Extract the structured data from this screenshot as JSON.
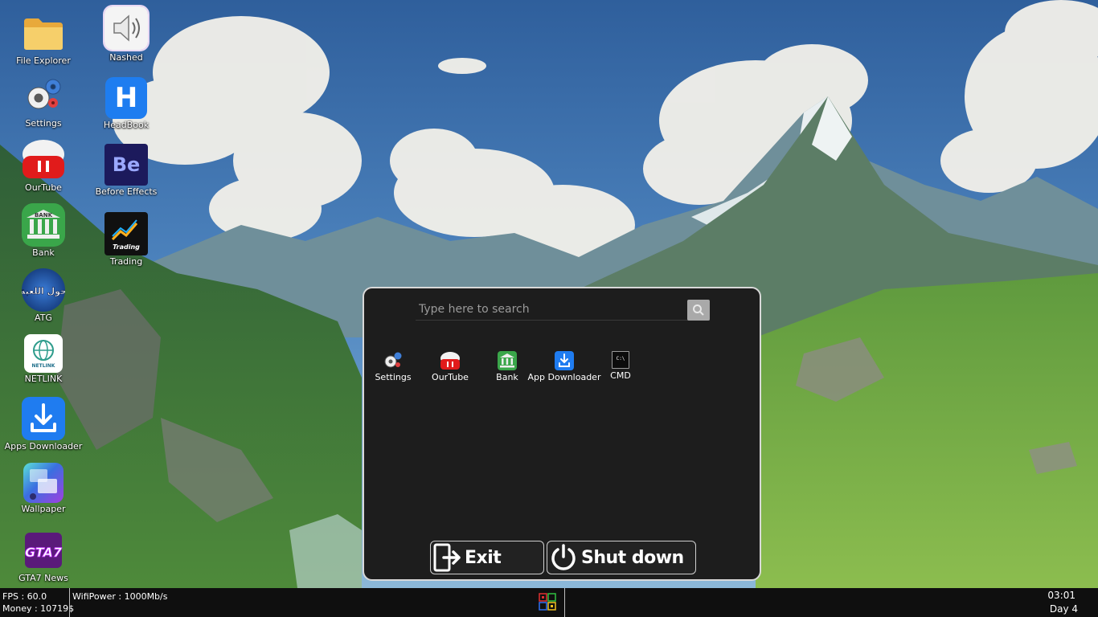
{
  "desktop": {
    "icons": [
      {
        "label": "File Explorer"
      },
      {
        "label": "Nashed"
      },
      {
        "label": "Settings"
      },
      {
        "label": "HeadBook"
      },
      {
        "label": "OurTube"
      },
      {
        "label": "Before Effects"
      },
      {
        "label": "Bank"
      },
      {
        "label": "Trading"
      },
      {
        "label": "ATG"
      },
      {
        "label": "NETLINK"
      },
      {
        "label": "Apps Downloader"
      },
      {
        "label": "Wallpaper"
      },
      {
        "label": "GTA7 News"
      }
    ],
    "icon_text": {
      "headbook": "H",
      "before_effects": "Be",
      "bank": "BANK",
      "trading": "Trading",
      "atg": "حول اللعبة",
      "netlink": "NETLINK",
      "gta": "GTA7"
    }
  },
  "start_menu": {
    "search_placeholder": "Type here to search",
    "apps": [
      {
        "label": "Settings"
      },
      {
        "label": "OurTube"
      },
      {
        "label": "Bank"
      },
      {
        "label": "App Downloader"
      },
      {
        "label": "CMD"
      }
    ],
    "cmd_icon_text": "C:\\",
    "exit_label": "Exit",
    "shutdown_label": "Shut down"
  },
  "taskbar": {
    "fps": "FPS : 60.0",
    "money": "Money : 10719$",
    "wifi": "WifiPower : 1000Mb/s",
    "time": "03:01",
    "day": "Day 4"
  },
  "colors": {
    "menu_bg": "#1d1d1d",
    "taskbar_bg": "#0f0f0f",
    "menu_border": "#d8d8d8"
  }
}
